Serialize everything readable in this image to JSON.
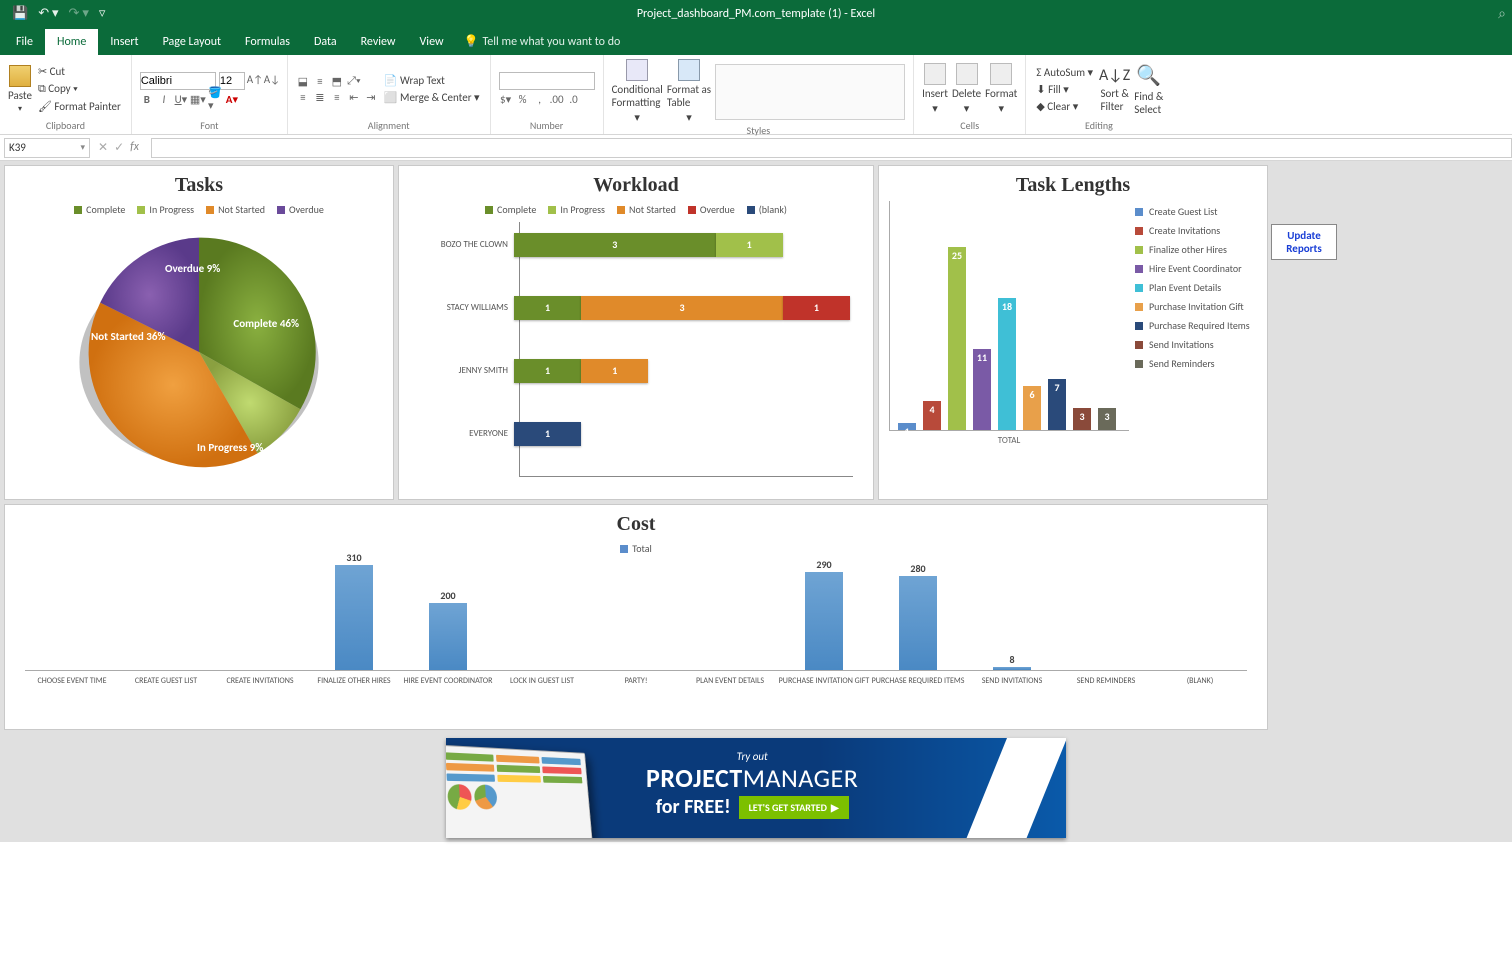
{
  "titlebar": {
    "title": "Project_dashboard_PM.com_template (1) - Excel"
  },
  "tabs": {
    "file": "File",
    "home": "Home",
    "insert": "Insert",
    "pagelayout": "Page Layout",
    "formulas": "Formulas",
    "data": "Data",
    "review": "Review",
    "view": "View",
    "tell": "Tell me what you want to do"
  },
  "ribbon": {
    "clipboard": {
      "paste": "Paste",
      "cut": "Cut",
      "copy": "Copy",
      "fp": "Format Painter",
      "label": "Clipboard"
    },
    "font": {
      "name": "Calibri",
      "size": "12",
      "label": "Font"
    },
    "alignment": {
      "wrap": "Wrap Text",
      "merge": "Merge & Center",
      "label": "Alignment"
    },
    "number": {
      "label": "Number"
    },
    "styles": {
      "cf": "Conditional\nFormatting",
      "fat": "Format as\nTable",
      "label": "Styles"
    },
    "cells": {
      "ins": "Insert",
      "del": "Delete",
      "fmt": "Format",
      "label": "Cells"
    },
    "editing": {
      "asum": "AutoSum",
      "fill": "Fill",
      "clear": "Clear",
      "sort": "Sort &\nFilter",
      "find": "Find &\nSelect",
      "label": "Editing"
    }
  },
  "formulaBar": {
    "cell": "K39"
  },
  "updateBtn": "Update\nReports",
  "tasksChart": {
    "title": "Tasks",
    "legend": [
      "Complete",
      "In Progress",
      "Not Started",
      "Overdue"
    ],
    "slices": [
      {
        "name": "Complete",
        "pct": 46,
        "label": "Complete\n46%"
      },
      {
        "name": "In Progress",
        "pct": 9,
        "label": "In Progress\n9%"
      },
      {
        "name": "Not Started",
        "pct": 36,
        "label": "Not Started\n36%"
      },
      {
        "name": "Overdue",
        "pct": 9,
        "label": "Overdue\n9%"
      }
    ]
  },
  "workloadChart": {
    "title": "Workload",
    "legend": [
      "Complete",
      "In Progress",
      "Not Started",
      "Overdue",
      "(blank)"
    ],
    "xmax": 5,
    "rows": [
      {
        "name": "BOZO THE CLOWN",
        "bars": [
          {
            "s": "Complete",
            "v": 3
          },
          {
            "s": "In Progress",
            "v": 1
          }
        ]
      },
      {
        "name": "STACY WILLIAMS",
        "bars": [
          {
            "s": "Complete",
            "v": 1
          },
          {
            "s": "Not Started",
            "v": 3
          },
          {
            "s": "Overdue",
            "v": 1
          }
        ]
      },
      {
        "name": "JENNY SMITH",
        "bars": [
          {
            "s": "Complete",
            "v": 1
          },
          {
            "s": "Not Started",
            "v": 1
          }
        ]
      },
      {
        "name": "EVERYONE",
        "bars": [
          {
            "s": "(blank)",
            "v": 1
          }
        ]
      }
    ]
  },
  "lengthsChart": {
    "title": "Task Lengths",
    "xlabel": "TOTAL",
    "ymax": 30,
    "series": [
      {
        "name": "Create Guest List",
        "v": 1
      },
      {
        "name": "Create Invitations",
        "v": 4
      },
      {
        "name": "Finalize other Hires",
        "v": 25
      },
      {
        "name": "Hire Event Coordinator",
        "v": 11
      },
      {
        "name": "Plan Event Details",
        "v": 18
      },
      {
        "name": "Purchase Invitation Gift",
        "v": 6
      },
      {
        "name": "Purchase Required Items",
        "v": 7
      },
      {
        "name": "Send Invitations",
        "v": 3
      },
      {
        "name": "Send Reminders",
        "v": 3
      }
    ]
  },
  "costChart": {
    "title": "Cost",
    "legend": [
      "Total"
    ],
    "ymax": 320,
    "cats": [
      {
        "name": "CHOOSE EVENT TIME",
        "v": 0
      },
      {
        "name": "CREATE GUEST LIST",
        "v": 0
      },
      {
        "name": "CREATE INVITATIONS",
        "v": 0
      },
      {
        "name": "FINALIZE OTHER HIRES",
        "v": 310
      },
      {
        "name": "HIRE EVENT COORDINATOR",
        "v": 200
      },
      {
        "name": "LOCK IN GUEST LIST",
        "v": 0
      },
      {
        "name": "PARTY!",
        "v": 0
      },
      {
        "name": "PLAN EVENT DETAILS",
        "v": 0
      },
      {
        "name": "PURCHASE INVITATION GIFT",
        "v": 290
      },
      {
        "name": "PURCHASE REQUIRED ITEMS",
        "v": 280
      },
      {
        "name": "SEND INVITATIONS",
        "v": 8
      },
      {
        "name": "SEND REMINDERS",
        "v": 0
      },
      {
        "name": "(BLANK)",
        "v": 0
      }
    ]
  },
  "banner": {
    "p1": "Try out",
    "p2a": "PROJECT",
    "p2b": "MANAGER",
    "free": "for FREE!",
    "cta": "LET'S GET STARTED"
  },
  "chart_data": [
    {
      "type": "pie",
      "title": "Tasks",
      "categories": [
        "Complete",
        "In Progress",
        "Not Started",
        "Overdue"
      ],
      "values": [
        46,
        9,
        36,
        9
      ]
    },
    {
      "type": "bar",
      "orientation": "horizontal",
      "stacked": true,
      "title": "Workload",
      "categories": [
        "BOZO THE CLOWN",
        "STACY WILLIAMS",
        "JENNY SMITH",
        "EVERYONE"
      ],
      "series": [
        {
          "name": "Complete",
          "values": [
            3,
            1,
            1,
            0
          ]
        },
        {
          "name": "In Progress",
          "values": [
            1,
            0,
            0,
            0
          ]
        },
        {
          "name": "Not Started",
          "values": [
            0,
            3,
            1,
            0
          ]
        },
        {
          "name": "Overdue",
          "values": [
            0,
            1,
            0,
            0
          ]
        },
        {
          "name": "(blank)",
          "values": [
            0,
            0,
            0,
            1
          ]
        }
      ]
    },
    {
      "type": "bar",
      "title": "Task Lengths",
      "xlabel": "TOTAL",
      "categories": [
        "Create Guest List",
        "Create Invitations",
        "Finalize other Hires",
        "Hire Event Coordinator",
        "Plan Event Details",
        "Purchase Invitation Gift",
        "Purchase Required Items",
        "Send Invitations",
        "Send Reminders"
      ],
      "values": [
        1,
        4,
        25,
        11,
        18,
        6,
        7,
        3,
        3
      ]
    },
    {
      "type": "bar",
      "title": "Cost",
      "legend": [
        "Total"
      ],
      "categories": [
        "CHOOSE EVENT TIME",
        "CREATE GUEST LIST",
        "CREATE INVITATIONS",
        "FINALIZE OTHER HIRES",
        "HIRE EVENT COORDINATOR",
        "LOCK IN GUEST LIST",
        "PARTY!",
        "PLAN EVENT DETAILS",
        "PURCHASE INVITATION GIFT",
        "PURCHASE REQUIRED ITEMS",
        "SEND INVITATIONS",
        "SEND REMINDERS",
        "(BLANK)"
      ],
      "values": [
        0,
        0,
        0,
        310,
        200,
        0,
        0,
        0,
        290,
        280,
        8,
        0,
        0
      ]
    }
  ]
}
